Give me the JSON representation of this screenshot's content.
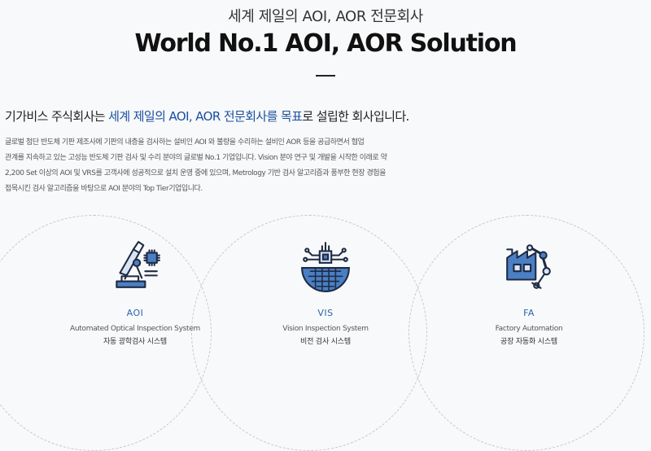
{
  "hero": {
    "subtitle": "세계 제일의 AOI, AOR 전문회사",
    "title": "World No.1 AOI, AOR Solution"
  },
  "intro": {
    "heading_prefix": "기가비스 주식회사는 ",
    "heading_highlight": "세계 제일의 AOI, AOR 전문회사를 목표",
    "heading_suffix": "로 설립한 회사입니다.",
    "body_lines": [
      "글로벌 첨단 반도체 기판 제조사에 기판의 내층을 검사하는 설비인 AOI 와 불량을 수리하는 설비인 AOR 등을 공급하면서 협업",
      "관계를 지속하고 있는 고성능 반도체 기판 검사 및 수리 분야의 글로벌 No.1 기업입니다. Vision 분야 연구 및 개발을 시작한 이래로 약",
      "2,200 Set 이상의 AOI 및 VRS를 고객사에 성공적으로 설치 운영 중에 있으며, Metrology 기반 검사 알고리즘과 풍부한 현장 경험을",
      "접목시킨 검사 알고리즘을 바탕으로 AOI 분야의 Top Tier기업입니다."
    ]
  },
  "products": [
    {
      "code": "AOI",
      "name_en": "Automated Optical Inspection System",
      "name_ko": "자동 광학검사 시스템",
      "icon": "microscope-chip-icon"
    },
    {
      "code": "VIS",
      "name_en": "Vision Inspection System",
      "name_ko": "비전 검사 시스템",
      "icon": "wafer-chip-icon"
    },
    {
      "code": "FA",
      "name_en": "Factory Automation",
      "name_ko": "공장 자동화 시스템",
      "icon": "factory-robot-arm-icon"
    }
  ],
  "colors": {
    "accent": "#2d62b0",
    "icon_blue": "#4a7fc4",
    "icon_dark": "#1f2a44"
  }
}
